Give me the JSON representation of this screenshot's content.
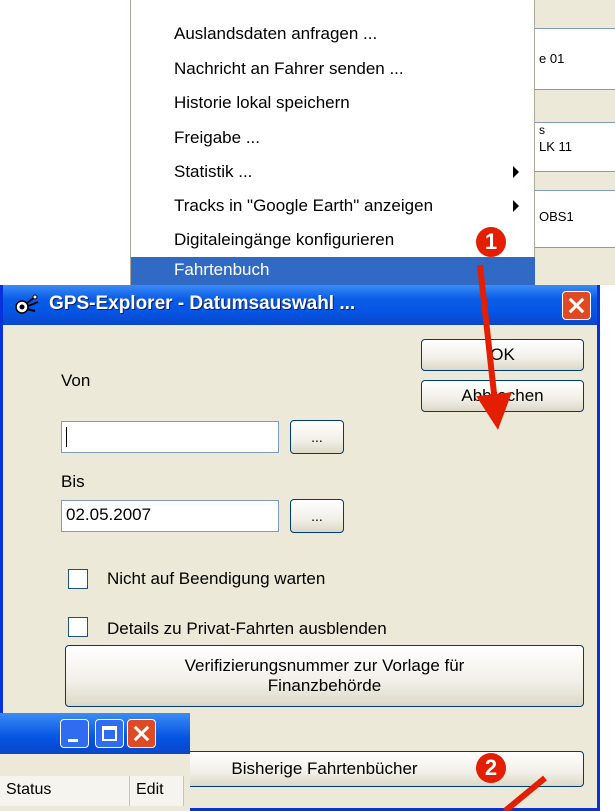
{
  "background_app": {
    "strip1": "e 01",
    "strip2_top": "s",
    "strip2": "LK 11",
    "strip3": "OBS1"
  },
  "context_menu": {
    "items": [
      {
        "label": "Auslandsdaten anfragen ...",
        "submenu": false,
        "highlighted": false
      },
      {
        "label": "Nachricht an Fahrer senden ...",
        "submenu": false,
        "highlighted": false
      },
      {
        "label": "Historie lokal speichern",
        "submenu": false,
        "highlighted": false
      },
      {
        "label": "Freigabe ...",
        "submenu": false,
        "highlighted": false
      },
      {
        "label": "Statistik ...",
        "submenu": true,
        "highlighted": false
      },
      {
        "label": "Tracks in \"Google Earth\" anzeigen",
        "submenu": true,
        "highlighted": false
      },
      {
        "label": "Digitaleingänge konfigurieren",
        "submenu": false,
        "highlighted": false
      },
      {
        "label": "Fahrtenbuch",
        "submenu": false,
        "highlighted": true
      }
    ]
  },
  "dialog": {
    "title": "GPS-Explorer - Datumsauswahl ...",
    "von_label": "Von",
    "von_value": "",
    "bis_label": "Bis",
    "bis_value": "02.05.2007",
    "browse_label": "...",
    "ok_label": "OK",
    "cancel_label": "Abbrechen",
    "checkbox1_label": "Nicht auf Beendigung warten",
    "checkbox1_checked": false,
    "checkbox2_label": "Details zu Privat-Fahrten ausblenden",
    "checkbox2_checked": false,
    "verify_label_line1": "Verifizierungsnummer zur Vorlage für",
    "verify_label_line2": "Finanzbehörde",
    "history_label": "Bisherige Fahrtenbücher"
  },
  "small_window": {
    "headers": [
      "Status",
      "Edit"
    ]
  },
  "annotations": {
    "badge1": "1",
    "badge2": "2",
    "color": "#e41e00"
  }
}
